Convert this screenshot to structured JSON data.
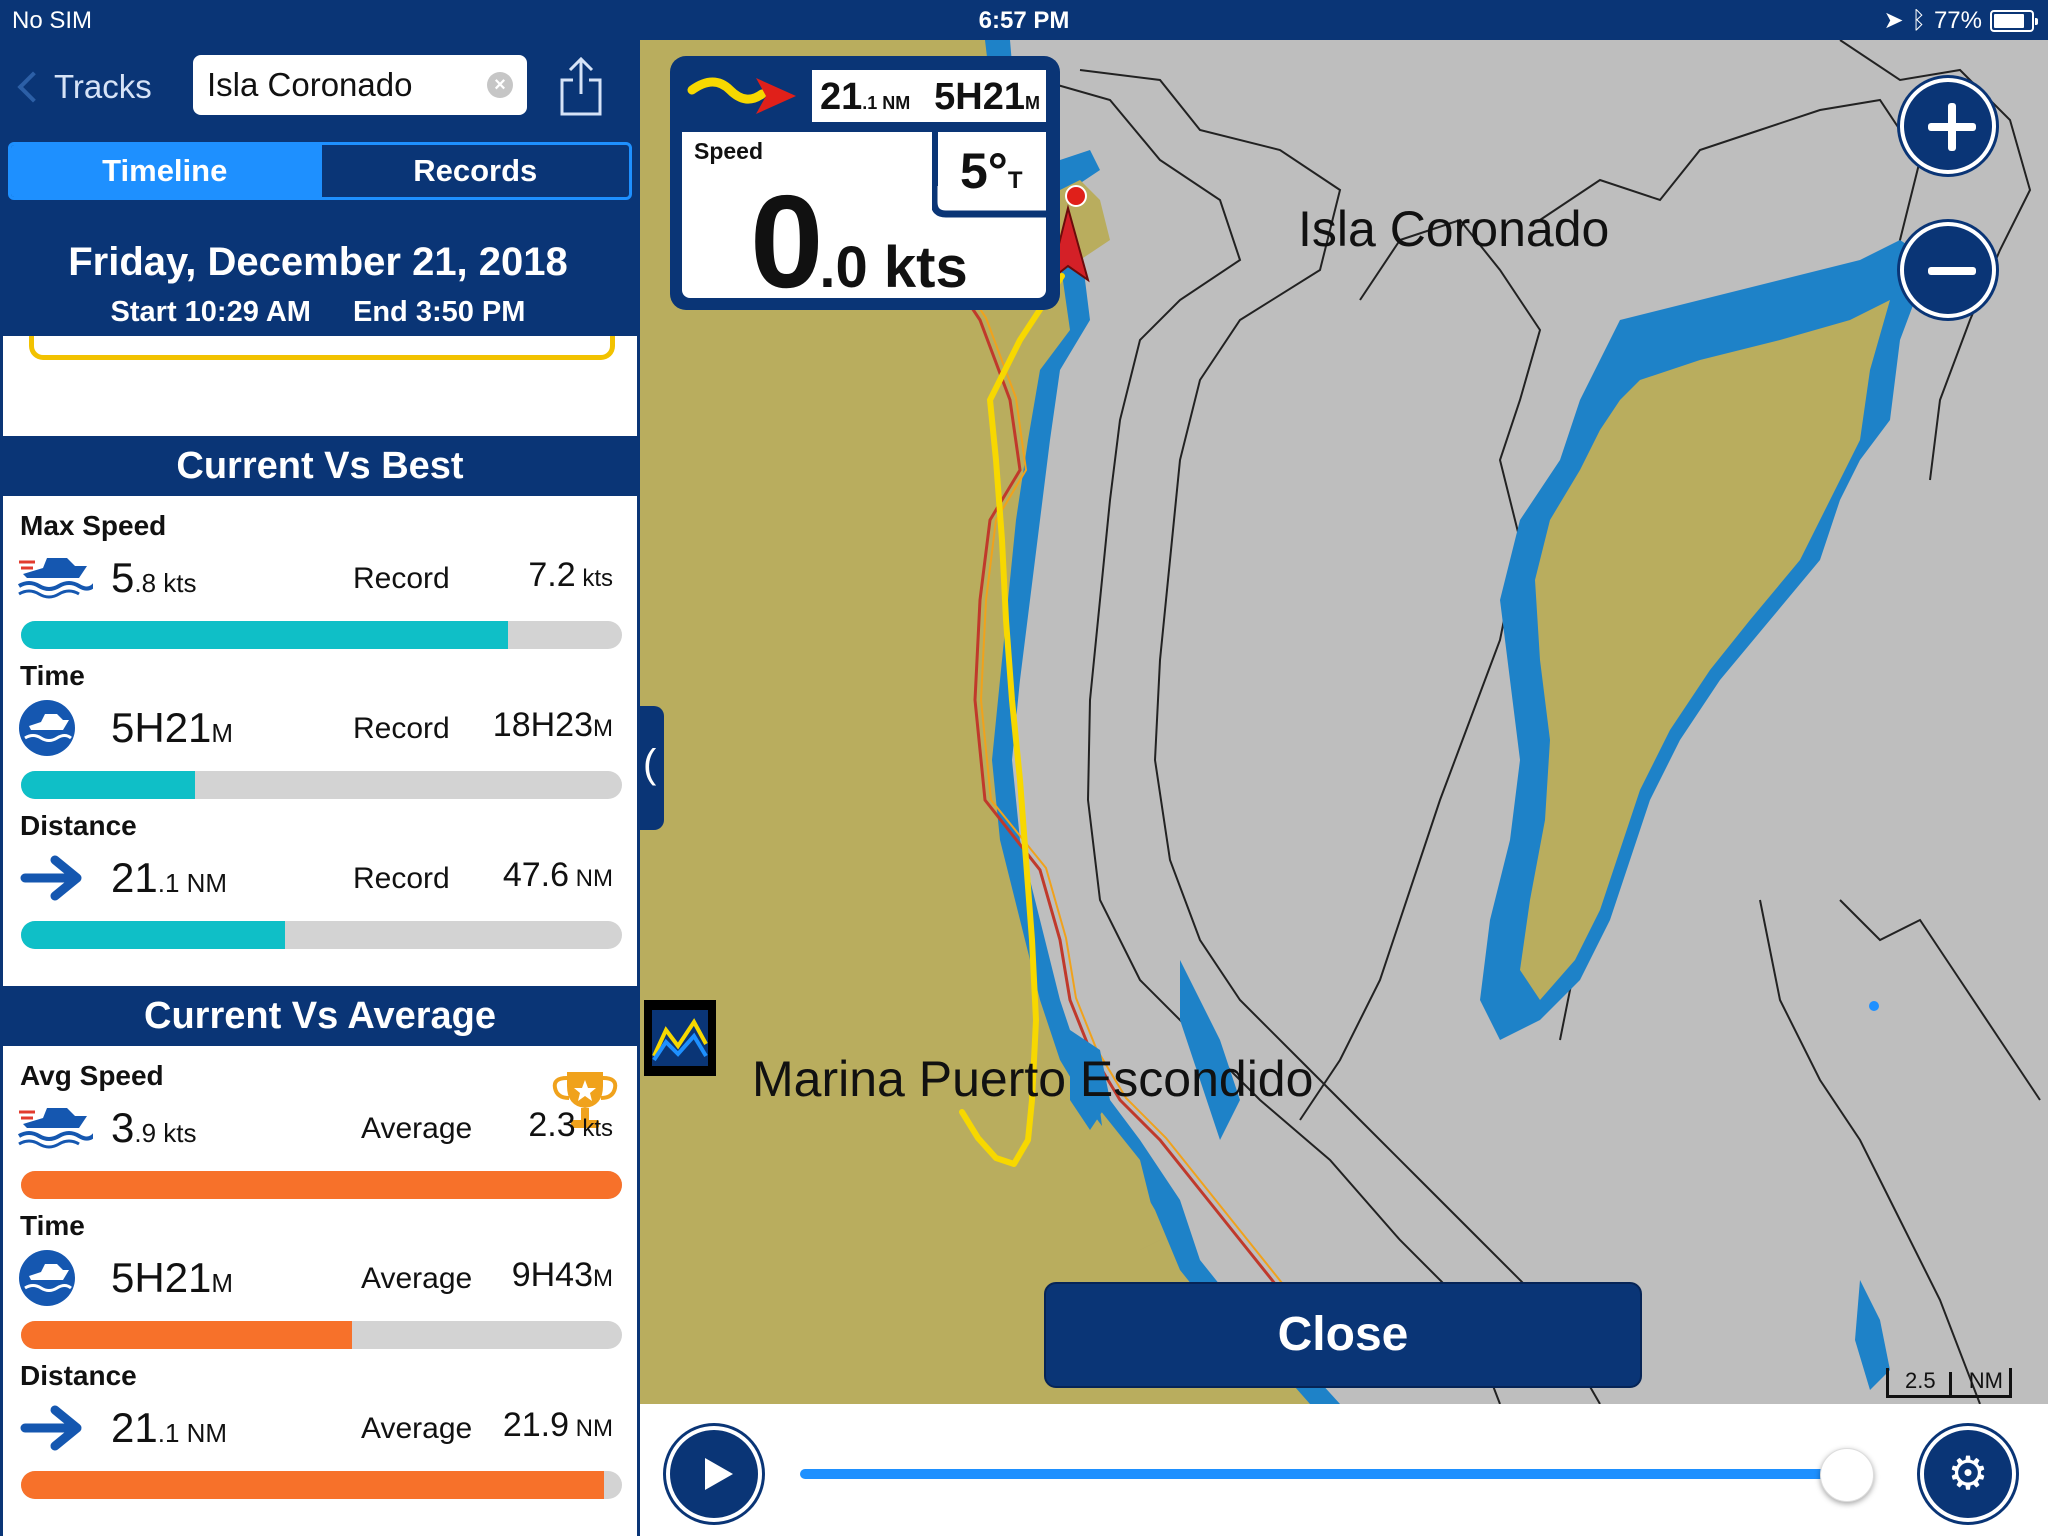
{
  "status_bar": {
    "carrier": "No SIM",
    "time": "6:57 PM",
    "battery": "77%"
  },
  "nav": {
    "back_label": "Tracks",
    "search_value": "Isla Coronado"
  },
  "tabs": [
    {
      "label": "Timeline",
      "active": true
    },
    {
      "label": "Records",
      "active": false
    }
  ],
  "date_header": {
    "title": "Friday, December 21, 2018",
    "start": "Start 10:29 AM",
    "end": "End 3:50 PM"
  },
  "current_vs_best": {
    "title": "Current Vs Best",
    "metrics": [
      {
        "label": "Max Speed",
        "icon": "boat-speed-icon",
        "value_main": "5",
        "value_sub": ".8 kts",
        "compare_label": "Record",
        "compare_main": "7.2",
        "compare_sub": " kts",
        "progress": 0.81
      },
      {
        "label": "Time",
        "icon": "boat-clock-icon",
        "value_main": "5H21",
        "value_sub": "M",
        "compare_label": "Record",
        "compare_main": "18H23",
        "compare_sub": "M",
        "progress": 0.29
      },
      {
        "label": "Distance",
        "icon": "arrow-right-icon",
        "value_main": "21",
        "value_sub": ".1 NM",
        "compare_label": "Record",
        "compare_main": "47.6",
        "compare_sub": " NM",
        "progress": 0.44
      }
    ]
  },
  "current_vs_average": {
    "title": "Current Vs Average",
    "metrics": [
      {
        "label": "Avg Speed",
        "icon": "boat-speed-icon",
        "value_main": "3",
        "value_sub": ".9 kts",
        "compare_label": "Average",
        "compare_main": "2.3",
        "compare_sub": " kts",
        "progress": 1.0,
        "trophy": true
      },
      {
        "label": "Time",
        "icon": "boat-clock-icon",
        "value_main": "5H21",
        "value_sub": "M",
        "compare_label": "Average",
        "compare_main": "9H43",
        "compare_sub": "M",
        "progress": 0.55
      },
      {
        "label": "Distance",
        "icon": "arrow-right-icon",
        "value_main": "21",
        "value_sub": ".1 NM",
        "compare_label": "Average",
        "compare_main": "21.9",
        "compare_sub": " NM",
        "progress": 0.97
      }
    ]
  },
  "instrument": {
    "distance_main": "21",
    "distance_sub": ".1 NM",
    "duration_main": "5H21",
    "duration_sub": "M",
    "speed_label": "Speed",
    "speed_main": "0",
    "speed_sub": ".0 kts",
    "heading_main": "5°",
    "heading_sub": "T"
  },
  "map": {
    "labels": {
      "island": "Isla Coronado",
      "marina": "Marina Puerto Escondido"
    },
    "scale_value": "2.5",
    "scale_unit": "NM",
    "colors": {
      "land": "#b9ad5e",
      "shallow": "#1e82c8",
      "deep": "#bebebe",
      "track": "#f7d800"
    }
  },
  "close_label": "Close",
  "playback": {
    "progress": 0.98
  }
}
